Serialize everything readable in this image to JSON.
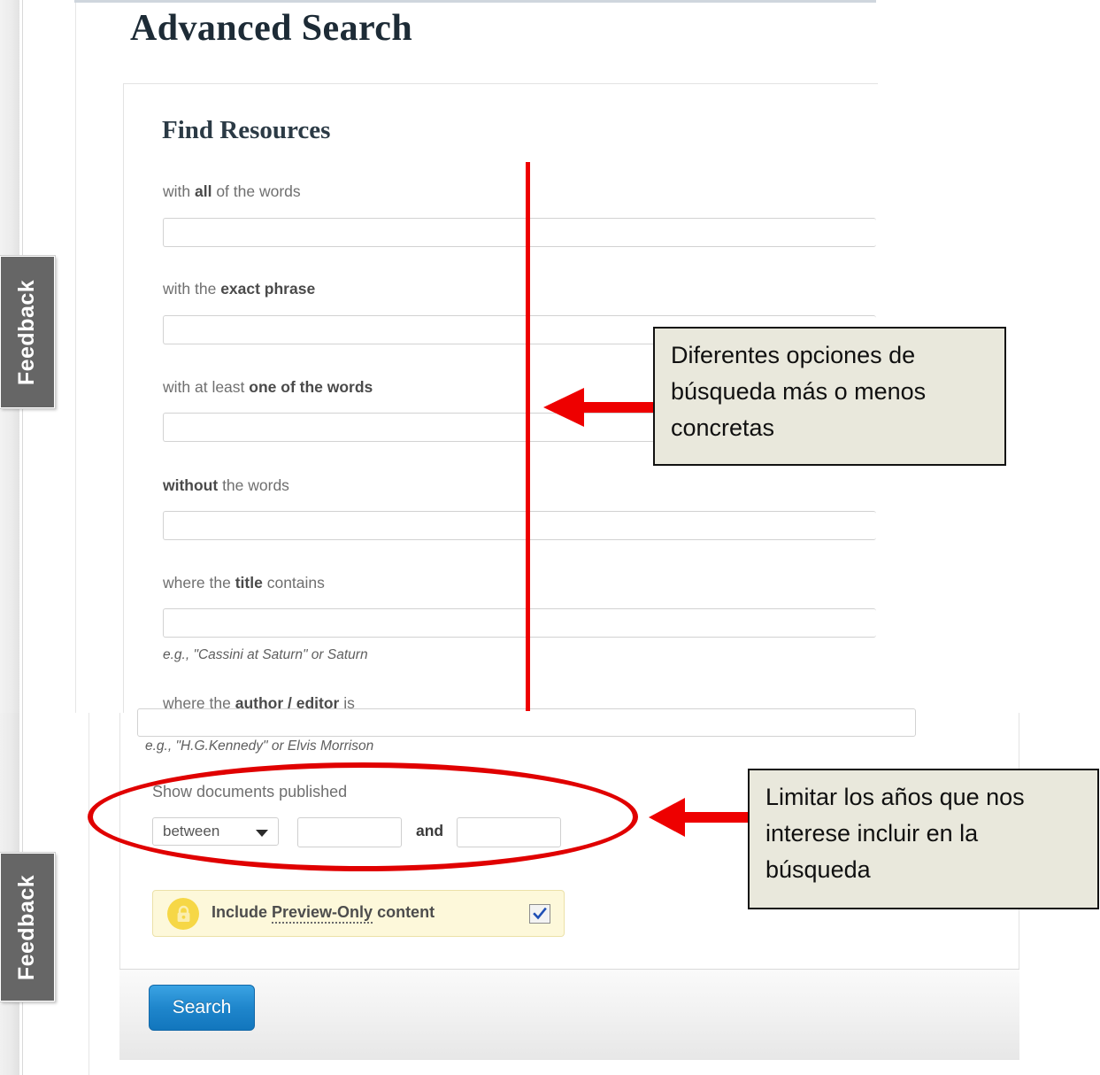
{
  "page": {
    "title": "Advanced Search",
    "panel_title": "Find Resources"
  },
  "feedback_tabs": [
    {
      "label": "Feedback"
    },
    {
      "label": "Feedback"
    }
  ],
  "form": {
    "fields": [
      {
        "label_pre": "with ",
        "label_bold": "all",
        "label_post": " of the words",
        "value": "",
        "hint": ""
      },
      {
        "label_pre": "with the ",
        "label_bold": "exact phrase",
        "label_post": "",
        "value": "",
        "hint": ""
      },
      {
        "label_pre": "with at least ",
        "label_bold": "one of the words",
        "label_post": "",
        "value": "",
        "hint": ""
      },
      {
        "label_pre": "",
        "label_bold": "without",
        "label_post": " the words",
        "value": "",
        "hint": ""
      },
      {
        "label_pre": "where the ",
        "label_bold": "title",
        "label_post": " contains",
        "value": "",
        "hint": "e.g., \"Cassini at Saturn\" or Saturn"
      },
      {
        "label_pre": "where the ",
        "label_bold": "author / editor",
        "label_post": " is",
        "value": "",
        "hint": "e.g., \"H.G.Kennedy\" or Elvis Morrison"
      }
    ],
    "date_range": {
      "label": "Show documents published",
      "operator_selected": "between",
      "operator_options": [
        "between"
      ],
      "year_from": "",
      "year_to": "",
      "conjunction": "and"
    },
    "preview_only": {
      "label_pre": "Include ",
      "label_link": "Preview-Only",
      "label_post": " content",
      "checked": true,
      "icon": "lock-icon",
      "background_color": "#fdf8da",
      "icon_color": "#f6d746"
    },
    "submit_label": "Search",
    "submit_color": "#1f86cc"
  },
  "annotations": {
    "accent_color": "#ee0000",
    "callout_background": "#e9e8dc",
    "callouts": [
      {
        "text": "Diferentes opciones de búsqueda más o menos concretas"
      },
      {
        "text": "Limitar los años que nos interese incluir en la búsqueda"
      }
    ]
  }
}
